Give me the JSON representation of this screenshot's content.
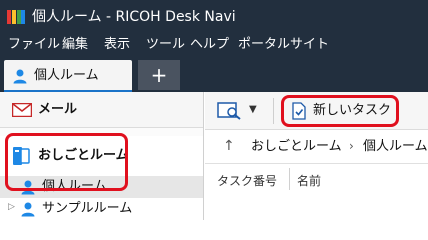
{
  "window": {
    "title": "個人ルーム - RICOH Desk Navi"
  },
  "menu": [
    "ファイル",
    "編集",
    "表示",
    "ツール",
    "ヘルプ",
    "ポータルサイト"
  ],
  "tabs": [
    {
      "label": "個人ルーム"
    }
  ],
  "add_tab_label": "+",
  "sidebar": {
    "mail_label": "メール",
    "room_label": "おしごとルーム",
    "tree": [
      {
        "label": "個人ルーム"
      },
      {
        "label": "サンプルルーム"
      }
    ]
  },
  "toolbar": {
    "new_task_label": "新しいタスク"
  },
  "breadcrumb": [
    "おしごとルーム",
    "個人ルーム"
  ],
  "breadcrumb_separator": "›",
  "table": {
    "columns": [
      "タスク番号",
      "名前"
    ]
  },
  "colors": {
    "titlebar": "#222f3e",
    "accent": "#1a73c8",
    "highlight": "#e0101e"
  }
}
